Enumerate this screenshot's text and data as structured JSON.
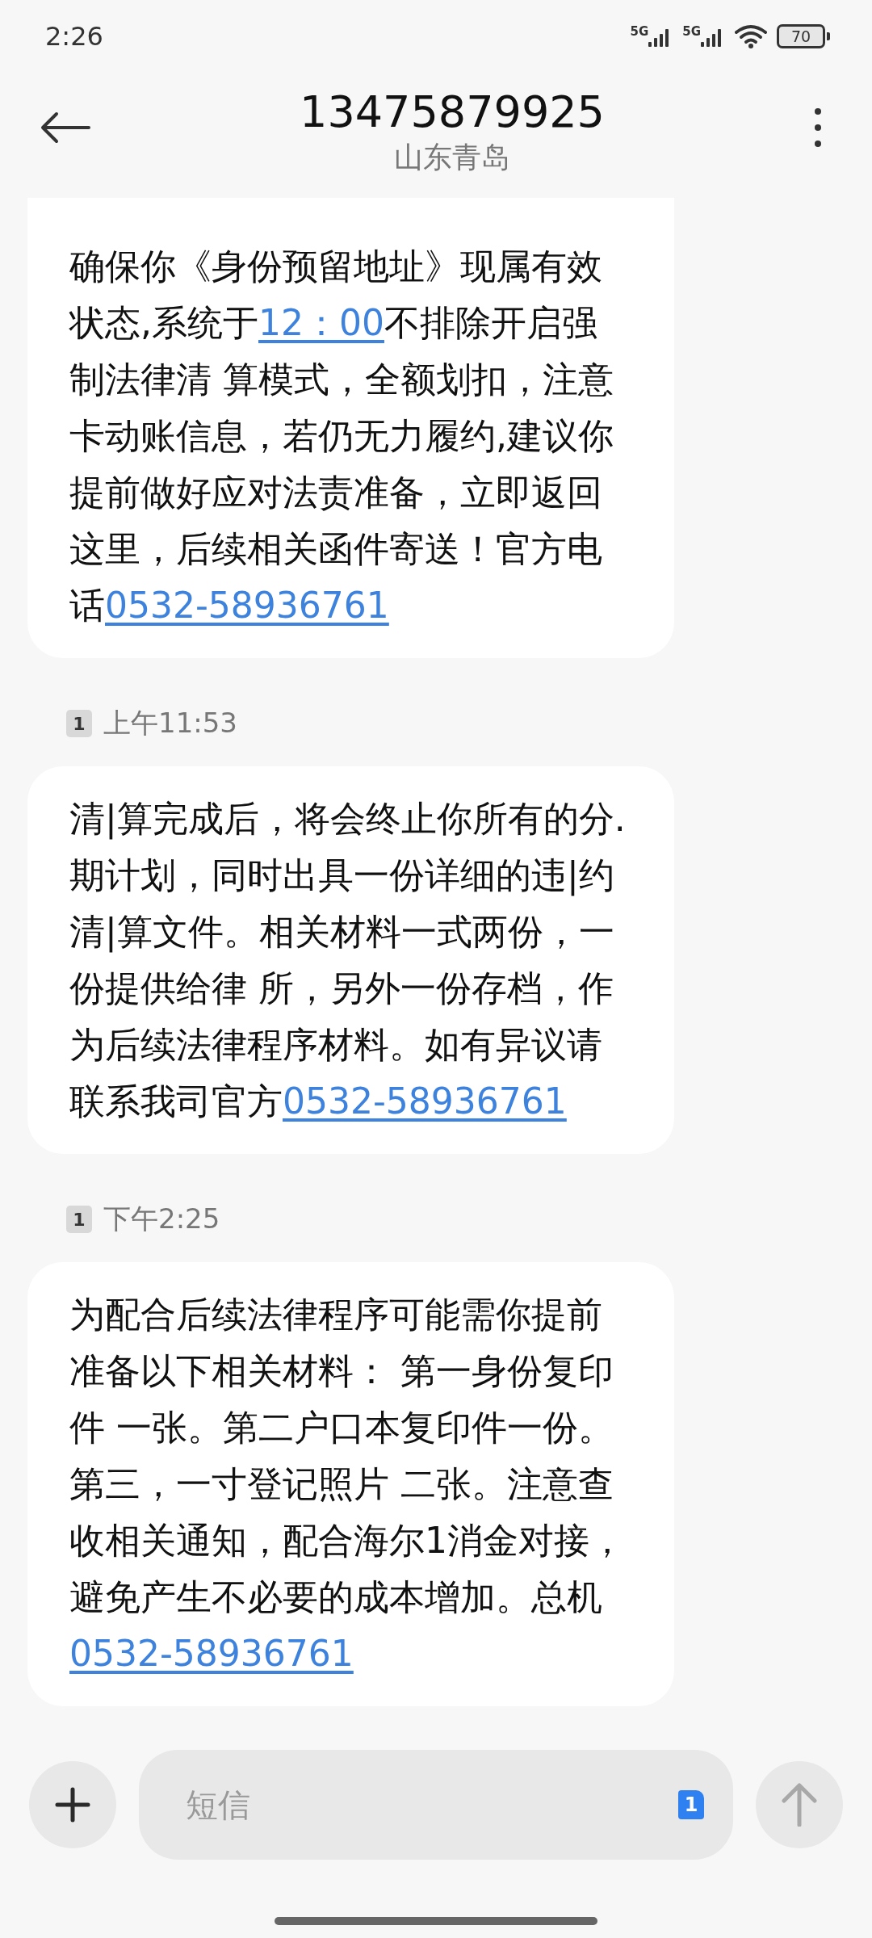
{
  "status_bar": {
    "time": "2:26",
    "networks": [
      "5G",
      "5G"
    ],
    "battery": "70"
  },
  "header": {
    "title": "13475879925",
    "subtitle": "山东青岛"
  },
  "messages": [
    {
      "segments": [
        {
          "kind": "text",
          "text": "确保你《身份预留地址》现属有效状态,系统于"
        },
        {
          "kind": "link",
          "text": "12：00"
        },
        {
          "kind": "text",
          "text": "不排除开启强制法律清 算模式，全额划扣，注意卡动账信息，若仍无力履约,建议你提前做好应对法责准备，立即返回这里，后续相关函件寄送！官方电话"
        },
        {
          "kind": "link",
          "text": "0532-58936761"
        }
      ]
    },
    {
      "sim": "1",
      "time": "上午11:53",
      "segments": [
        {
          "kind": "text",
          "text": "清|算完成后，将会终止你所有的分.期计划，同时出具一份详细的违|约清|算文件。相关材料一式两份，一份提供给律 所，另外一份存档，作为后续法律程序材料。如有异议请联系我司官方"
        },
        {
          "kind": "link",
          "text": "0532-58936761"
        }
      ]
    },
    {
      "sim": "1",
      "time": "下午2:25",
      "segments": [
        {
          "kind": "text",
          "text": "为配合后续法律程序可能需你提前准备以下相关材料： 第一身份复印件 一张。第二户口本复印件一份。第三，一寸登记照片 二张。注意查收相关通知，配合海尔1消金对接，避免产生不必要的成本增加。总机"
        },
        {
          "kind": "link",
          "text": "0532-58936761"
        }
      ]
    }
  ],
  "composer": {
    "placeholder": "短信",
    "sim": "1",
    "send_disabled": true
  }
}
